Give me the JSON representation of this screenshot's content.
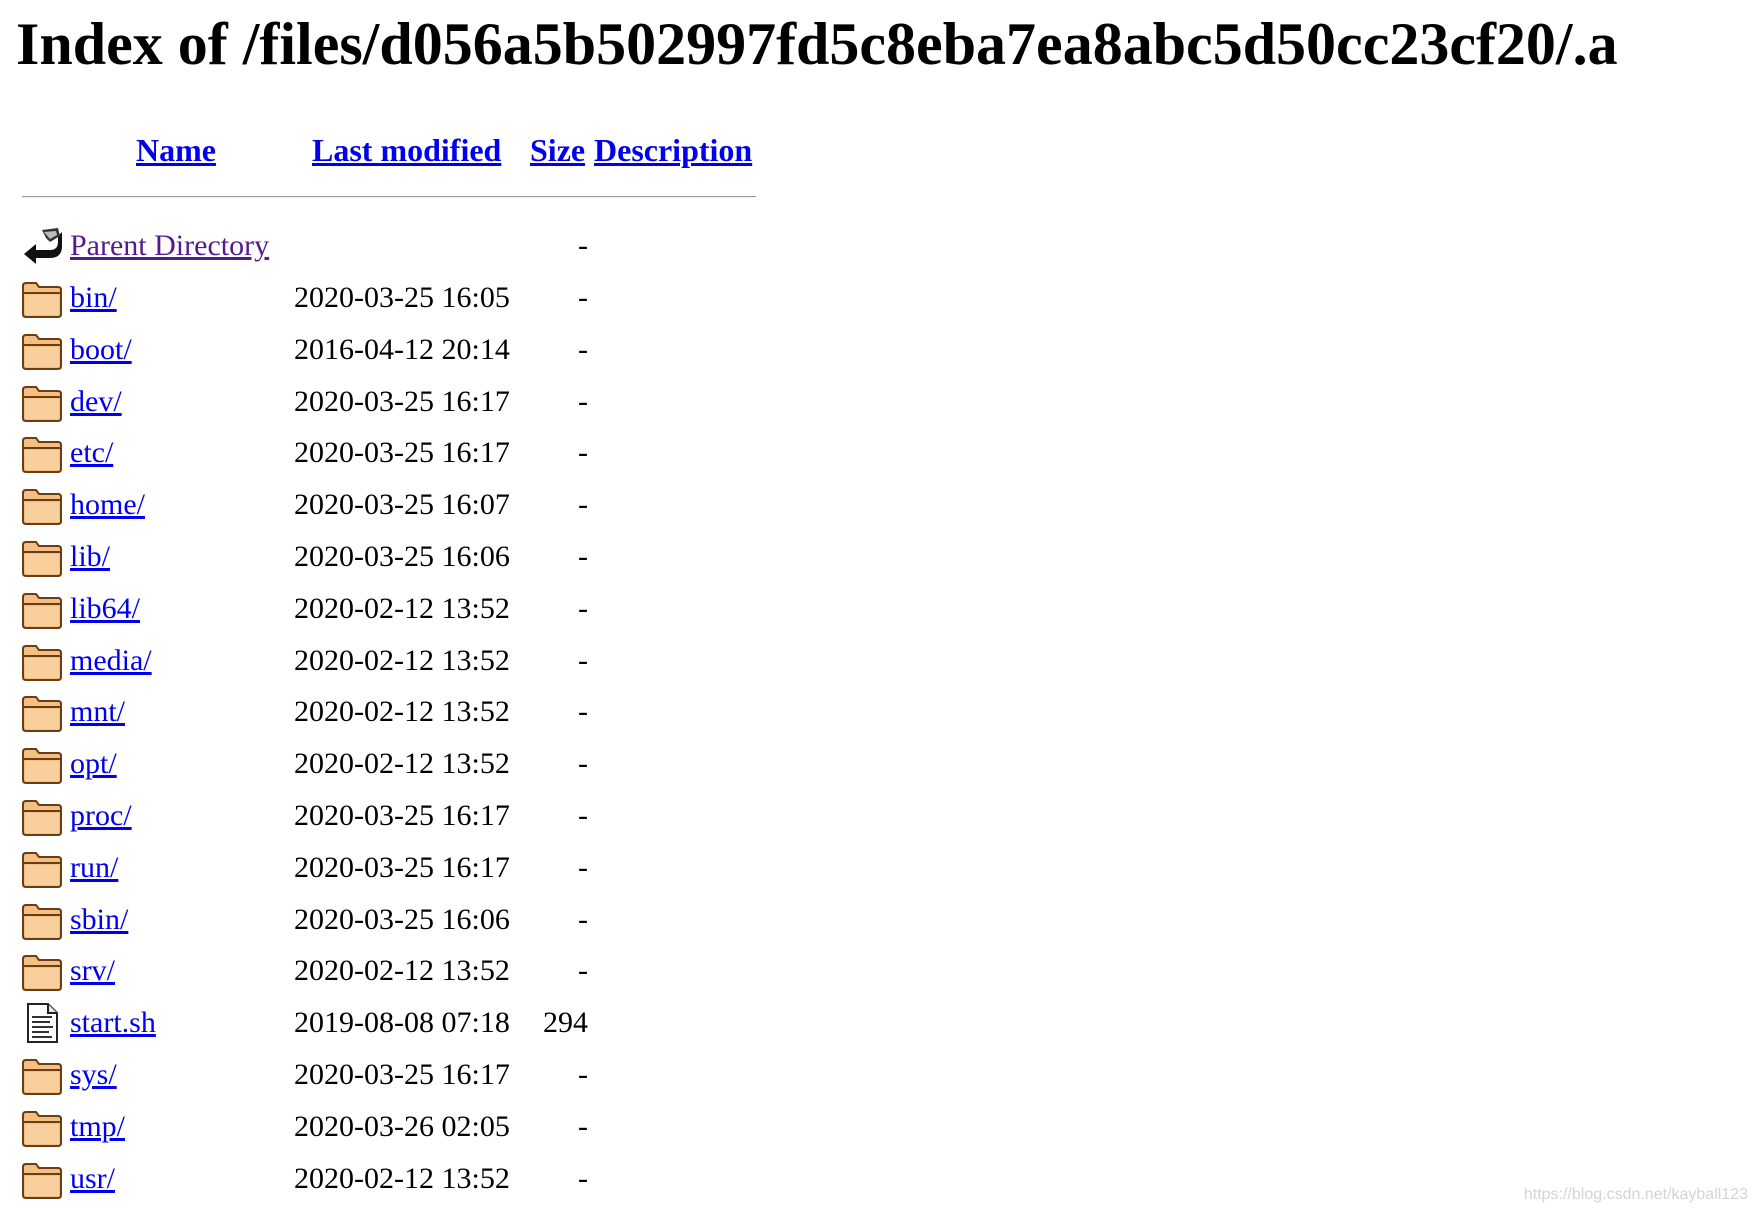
{
  "page": {
    "title": "Index of /files/d056a5b502997fd5c8eba7ea8abc5d50cc23cf20/.a"
  },
  "table": {
    "headers": {
      "name": "Name",
      "last_modified": "Last modified",
      "size": "Size",
      "description": "Description"
    },
    "parent": {
      "label": "Parent Directory",
      "size": "-",
      "icon": "back-arrow-icon"
    },
    "entries": [
      {
        "name": "bin/",
        "date": "2020-03-25 16:05",
        "size": "-",
        "icon": "folder-icon"
      },
      {
        "name": "boot/",
        "date": "2016-04-12 20:14",
        "size": "-",
        "icon": "folder-icon"
      },
      {
        "name": "dev/",
        "date": "2020-03-25 16:17",
        "size": "-",
        "icon": "folder-icon"
      },
      {
        "name": "etc/",
        "date": "2020-03-25 16:17",
        "size": "-",
        "icon": "folder-icon"
      },
      {
        "name": "home/",
        "date": "2020-03-25 16:07",
        "size": "-",
        "icon": "folder-icon"
      },
      {
        "name": "lib/",
        "date": "2020-03-25 16:06",
        "size": "-",
        "icon": "folder-icon"
      },
      {
        "name": "lib64/",
        "date": "2020-02-12 13:52",
        "size": "-",
        "icon": "folder-icon"
      },
      {
        "name": "media/",
        "date": "2020-02-12 13:52",
        "size": "-",
        "icon": "folder-icon"
      },
      {
        "name": "mnt/",
        "date": "2020-02-12 13:52",
        "size": "-",
        "icon": "folder-icon"
      },
      {
        "name": "opt/",
        "date": "2020-02-12 13:52",
        "size": "-",
        "icon": "folder-icon"
      },
      {
        "name": "proc/",
        "date": "2020-03-25 16:17",
        "size": "-",
        "icon": "folder-icon"
      },
      {
        "name": "run/",
        "date": "2020-03-25 16:17",
        "size": "-",
        "icon": "folder-icon"
      },
      {
        "name": "sbin/",
        "date": "2020-03-25 16:06",
        "size": "-",
        "icon": "folder-icon"
      },
      {
        "name": "srv/",
        "date": "2020-02-12 13:52",
        "size": "-",
        "icon": "folder-icon"
      },
      {
        "name": "start.sh",
        "date": "2019-08-08 07:18",
        "size": "294",
        "icon": "text-file-icon"
      },
      {
        "name": "sys/",
        "date": "2020-03-25 16:17",
        "size": "-",
        "icon": "folder-icon"
      },
      {
        "name": "tmp/",
        "date": "2020-03-26 02:05",
        "size": "-",
        "icon": "folder-icon"
      },
      {
        "name": "usr/",
        "date": "2020-02-12 13:52",
        "size": "-",
        "icon": "folder-icon"
      }
    ]
  },
  "watermark": "https://blog.csdn.net/kayball123",
  "colors": {
    "link": "#0000ee",
    "visited_link": "#551a8b",
    "folder_fill": "#f5be82",
    "folder_stroke": "#6b3d12"
  }
}
